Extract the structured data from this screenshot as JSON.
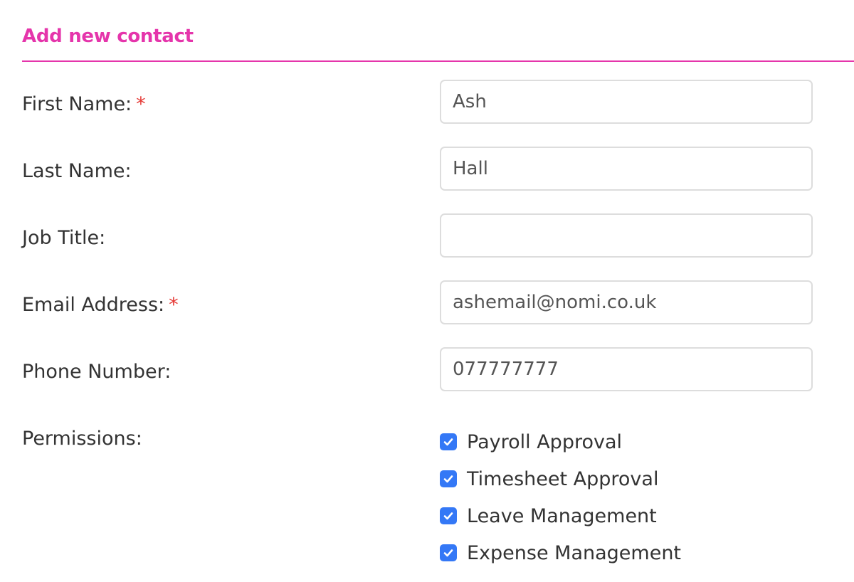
{
  "form": {
    "title": "Add new contact",
    "accent_color": "#e535ab",
    "required_marker": "*",
    "fields": [
      {
        "label": "First Name:",
        "required": true,
        "value": "Ash",
        "placeholder": ""
      },
      {
        "label": "Last Name:",
        "required": false,
        "value": "Hall",
        "placeholder": ""
      },
      {
        "label": "Job Title:",
        "required": false,
        "value": "",
        "placeholder": ""
      },
      {
        "label": "Email Address:",
        "required": true,
        "value": "ashemail@nomi.co.uk",
        "placeholder": ""
      },
      {
        "label": "Phone Number:",
        "required": false,
        "value": "077777777",
        "placeholder": ""
      }
    ],
    "permissions": {
      "label": "Permissions:",
      "checkbox_color": "#3478f6",
      "items": [
        {
          "label": "Payroll Approval",
          "checked": true
        },
        {
          "label": "Timesheet Approval",
          "checked": true
        },
        {
          "label": "Leave Management",
          "checked": true
        },
        {
          "label": "Expense Management",
          "checked": true
        }
      ]
    }
  }
}
